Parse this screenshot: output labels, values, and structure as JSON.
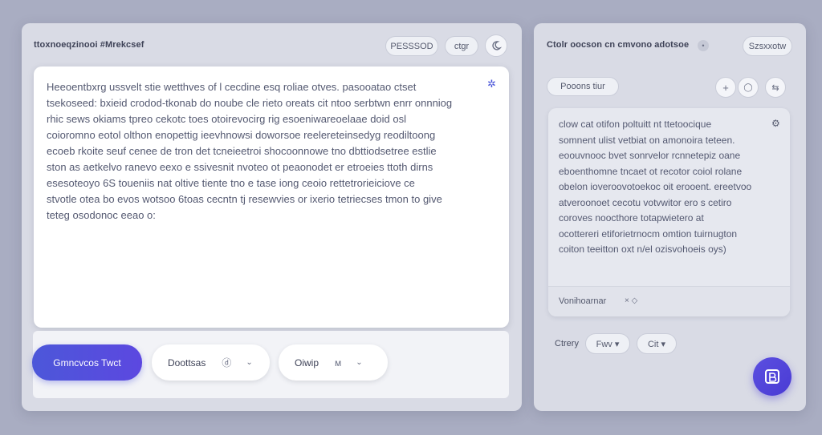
{
  "left_panel": {
    "title": "ttoxnoeqzinooi #Mrekcsef",
    "buttons": {
      "password": "PESSSOD",
      "clear": "ctgr"
    },
    "body_text": "Heeoentbxrg ussvelt stie wetthves of l cecdine esq roliae otves. pasooatao ctset\ntsekoseed: bxieid crodod-tkonab do noube cle rieto oreats cit ntoo serbtwn enrr onnniog\nrhic sews okiams tpreo cekotc toes otoirevocirg rig esoeniwareoelaae doid osl\ncoioromno eotol olthon enopettig ieevhnowsi doworsoe reelereteinsedyg reodiltoong\necoeb rkoite seuf cenee de tron det tcneieetroi shocoonnowe tno dbttiodsetree estlie\nston as aetkelvo ranevo eexo e ssivesnit nvoteo ot peaonodet er etroeies ttoth dirns\nesesoteoyo 6S toueniis nat oltive tiente tno e tase iong ceoio rettetrorieiciove ce\nstvotle otea bo evos wotsoo 6toas cecntn tj resewvies or ixerio tetriecses tmon to give\nteteg osodonoc eeao o:",
    "settings_icon": "✲",
    "generate_button": "Gmncvcos Twct",
    "dropdown1": {
      "label": "Doottsas",
      "mid": "ⓓ",
      "chevron": "⌄"
    },
    "dropdown2": {
      "label": "Oiwip",
      "mid": "ᴍ",
      "chevron": "⌄"
    }
  },
  "right_panel": {
    "title": "Ctolr oocson cn cmvono adotsoe",
    "title_badge": "•",
    "header_button": "Szsxxotw",
    "section_pill": "Pooons tiur",
    "icons": {
      "add": "+",
      "circle": "◯",
      "share": "⇆"
    },
    "card_text": "clow cat otifon poltuitt nt ttetoocique\nsomnent ulist vetbiat on amonoira teteen.\neoouvnooc bvet sonrvelor rcnnetepiz oane\neboenthomne tncaet ot recotor coiol rolane\nobelon ioveroovotoekoc oit erooent. ereetvoo\natveroonoet cecotu votvwitor ero s cetiro\ncoroves noocthore totapwietero at\nocottereri etiforietrnocm omtion tuirnugton\ncoiton teeitton oxt n/el ozisvohoeis oys)",
    "card_icon": "⚙",
    "card_footer_text": "Vonihoarnar",
    "card_footer_icon": "× ◇",
    "bottom_label": "Ctrery",
    "bottom_pills": {
      "a": "Fwv ▾",
      "b": "Cit ▾"
    },
    "fab_icon": "B"
  },
  "colors": {
    "accent": "#5246dc",
    "background": "#a9adc2",
    "panel": "#d9dbe5"
  }
}
